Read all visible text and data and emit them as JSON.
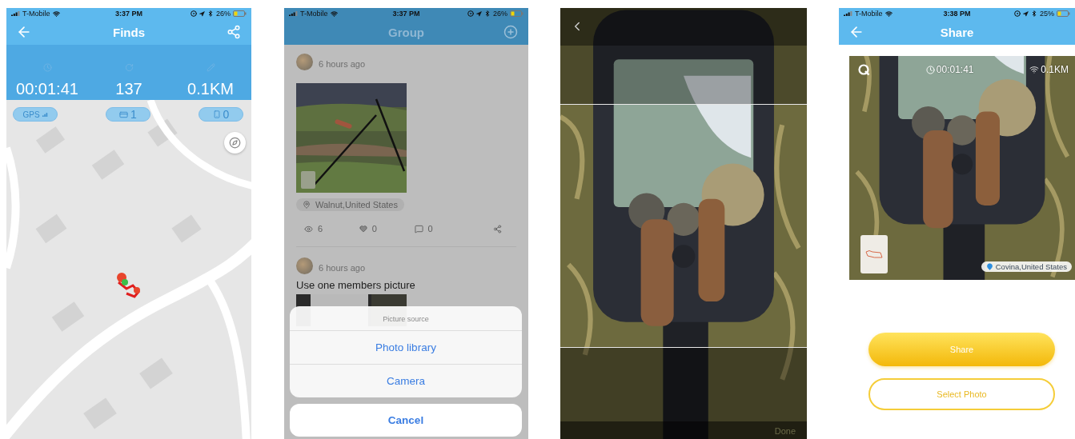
{
  "screens": [
    {
      "kind": "finds",
      "status_bar": {
        "carrier": "T-Mobile",
        "time": "3:37 PM",
        "battery": "26%"
      },
      "title": "Finds",
      "stats": [
        "00:01:41",
        "137",
        "0.1KM"
      ],
      "chips": [
        {
          "kind": "gps",
          "label": "GPS"
        },
        {
          "kind": "card",
          "label": "1"
        },
        {
          "kind": "phone",
          "label": "0"
        }
      ]
    },
    {
      "kind": "group",
      "status_bar": {
        "carrier": "T-Mobile",
        "time": "3:37 PM",
        "battery": "26%"
      },
      "title": "Group",
      "posts": [
        {
          "time": "6 hours ago",
          "location": "Walnut,United States",
          "views": "6",
          "likes": "0",
          "comments": "0"
        },
        {
          "time": "6 hours ago",
          "text": "Use one members picture"
        }
      ],
      "action_sheet": {
        "title": "Picture source",
        "options": [
          "Photo library",
          "Camera"
        ],
        "cancel": "Cancel"
      }
    },
    {
      "kind": "crop",
      "done": "Done"
    },
    {
      "kind": "share",
      "status_bar": {
        "carrier": "T-Mobile",
        "time": "3:38 PM",
        "battery": "25%"
      },
      "title": "Share",
      "photo": {
        "duration": "00:01:41",
        "distance": "0.1KM",
        "location": "Covina,United States"
      },
      "buttons": [
        {
          "kind": "primary",
          "label": "Share"
        },
        {
          "kind": "outline",
          "label": "Select Photo"
        }
      ]
    }
  ]
}
